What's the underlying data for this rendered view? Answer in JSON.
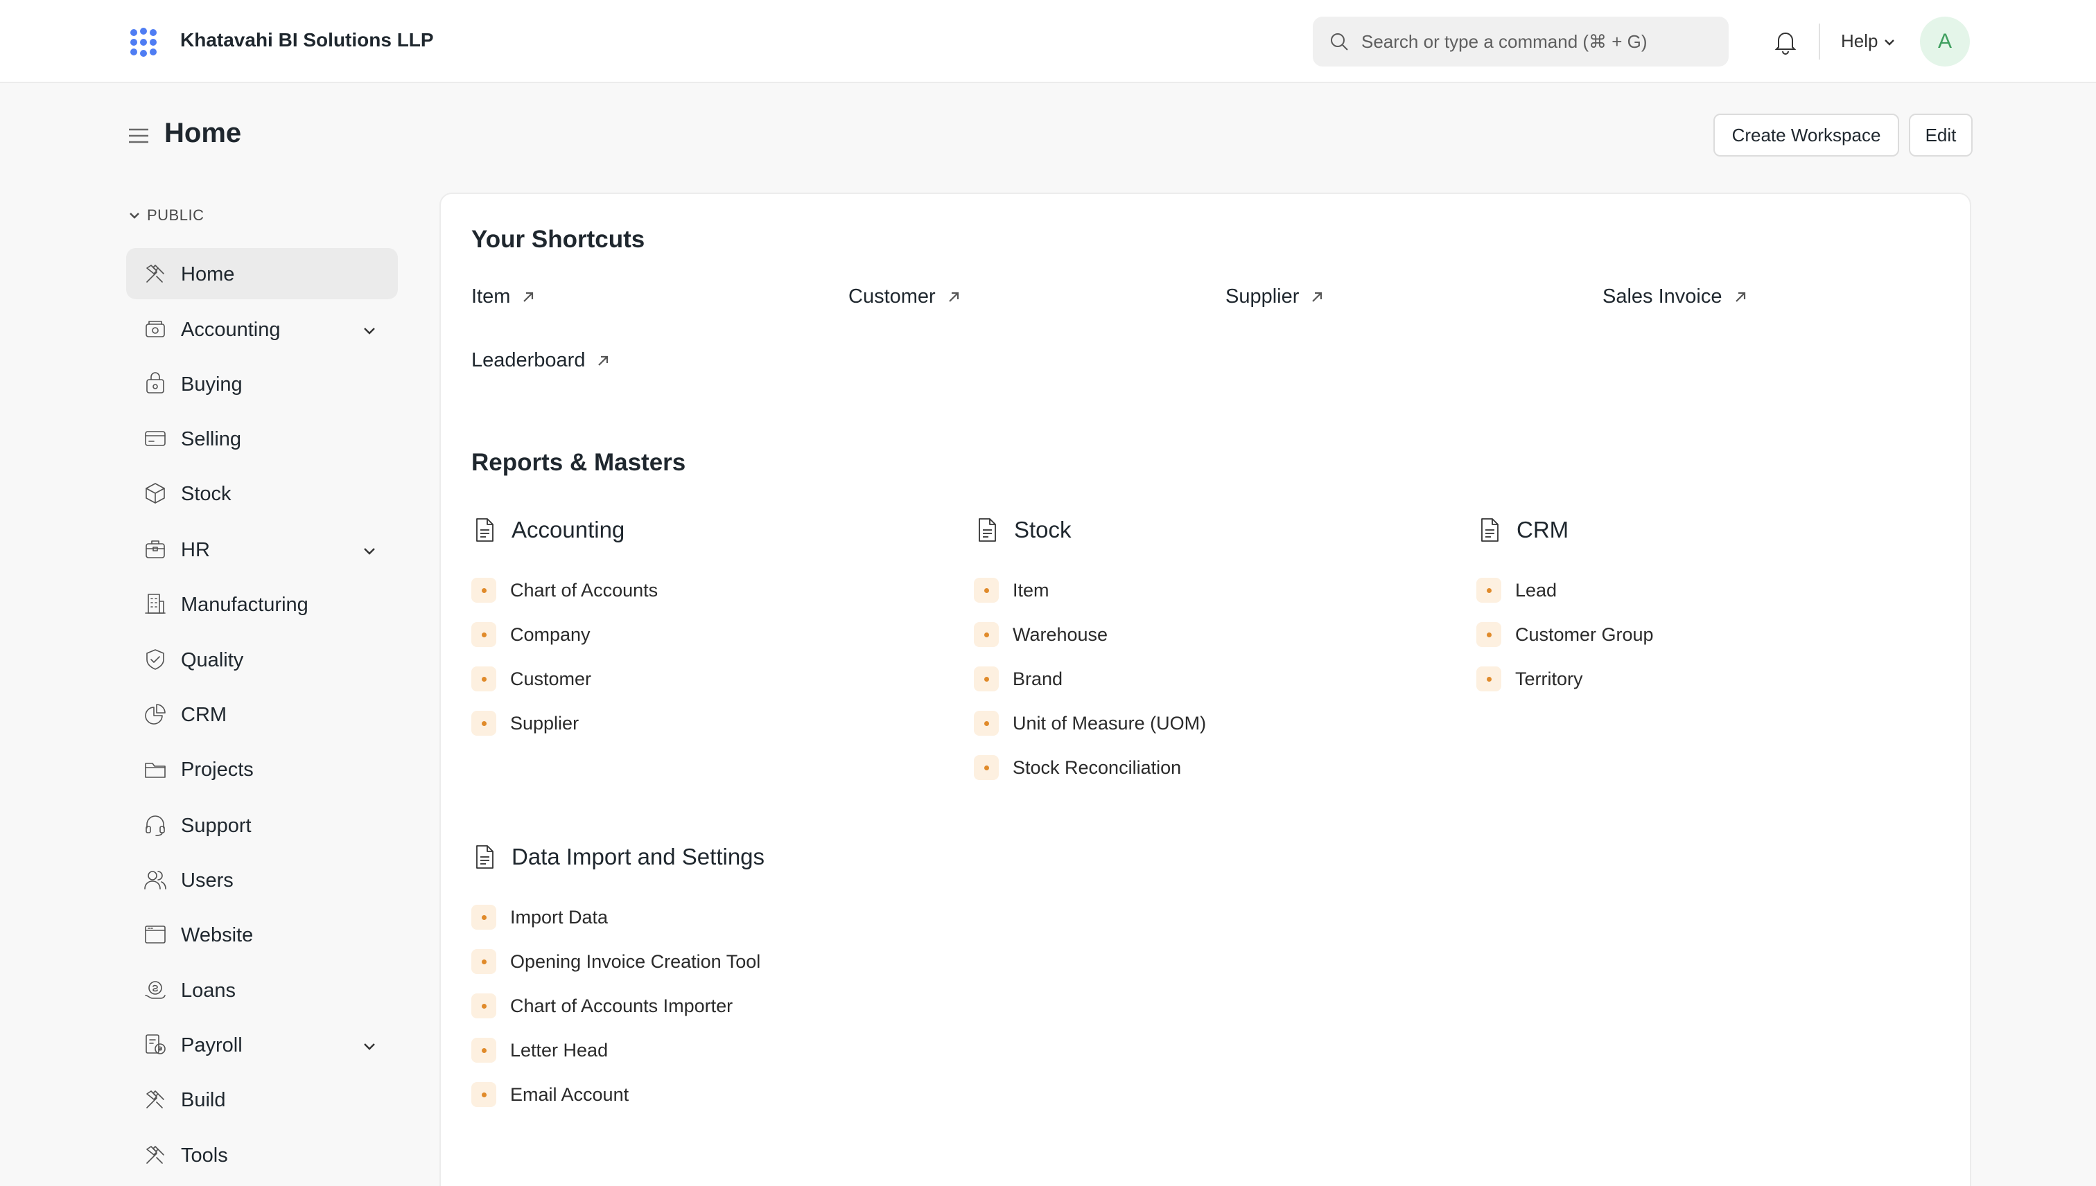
{
  "navbar": {
    "company": "Khatavahi BI Solutions LLP",
    "search_placeholder": "Search or type a command (⌘ + G)",
    "help_label": "Help",
    "avatar_initial": "A",
    "accent_color": "#4f7df3"
  },
  "page": {
    "title": "Home",
    "create_workspace_label": "Create Workspace",
    "edit_label": "Edit"
  },
  "sidebar": {
    "section_label": "PUBLIC",
    "items": [
      {
        "label": "Home",
        "icon": "home-tools-icon",
        "active": true
      },
      {
        "label": "Accounting",
        "icon": "accounting-icon",
        "expandable": true
      },
      {
        "label": "Buying",
        "icon": "buying-icon"
      },
      {
        "label": "Selling",
        "icon": "selling-icon"
      },
      {
        "label": "Stock",
        "icon": "stock-box-icon"
      },
      {
        "label": "HR",
        "icon": "hr-icon",
        "expandable": true
      },
      {
        "label": "Manufacturing",
        "icon": "manufacturing-icon"
      },
      {
        "label": "Quality",
        "icon": "quality-icon"
      },
      {
        "label": "CRM",
        "icon": "crm-icon"
      },
      {
        "label": "Projects",
        "icon": "projects-folder-icon"
      },
      {
        "label": "Support",
        "icon": "support-headset-icon"
      },
      {
        "label": "Users",
        "icon": "users-icon"
      },
      {
        "label": "Website",
        "icon": "website-icon"
      },
      {
        "label": "Loans",
        "icon": "loans-icon"
      },
      {
        "label": "Payroll",
        "icon": "payroll-icon",
        "expandable": true
      },
      {
        "label": "Build",
        "icon": "build-tools-icon"
      },
      {
        "label": "Tools",
        "icon": "tools-icon"
      }
    ]
  },
  "shortcuts": {
    "title": "Your Shortcuts",
    "items": [
      "Item",
      "Customer",
      "Supplier",
      "Sales Invoice",
      "Leaderboard"
    ]
  },
  "reports": {
    "title": "Reports & Masters",
    "groups": [
      {
        "title": "Accounting",
        "links": [
          "Chart of Accounts",
          "Company",
          "Customer",
          "Supplier"
        ]
      },
      {
        "title": "Stock",
        "links": [
          "Item",
          "Warehouse",
          "Brand",
          "Unit of Measure (UOM)",
          "Stock Reconciliation"
        ]
      },
      {
        "title": "CRM",
        "links": [
          "Lead",
          "Customer Group",
          "Territory"
        ]
      },
      {
        "title": "Data Import and Settings",
        "links": [
          "Import Data",
          "Opening Invoice Creation Tool",
          "Chart of Accounts Importer",
          "Letter Head",
          "Email Account"
        ]
      }
    ]
  }
}
